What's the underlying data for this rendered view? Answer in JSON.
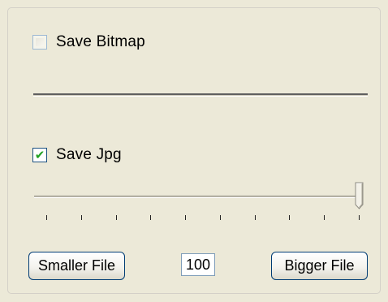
{
  "save_bitmap": {
    "label": "Save Bitmap",
    "checked": false,
    "enabled": false
  },
  "bitmap_slider": {
    "enabled": false
  },
  "save_jpg": {
    "label": "Save Jpg",
    "checked": true,
    "enabled": true
  },
  "quality_slider": {
    "value": 100,
    "min": 0,
    "max": 100,
    "tick_count": 10
  },
  "buttons": {
    "smaller": "Smaller File",
    "bigger": "Bigger File"
  },
  "quality_value": "100",
  "colors": {
    "background": "#ece9d8",
    "check_mark": "#21a121",
    "button_border": "#003c74"
  },
  "icons": {
    "check": "check-mark-icon"
  }
}
